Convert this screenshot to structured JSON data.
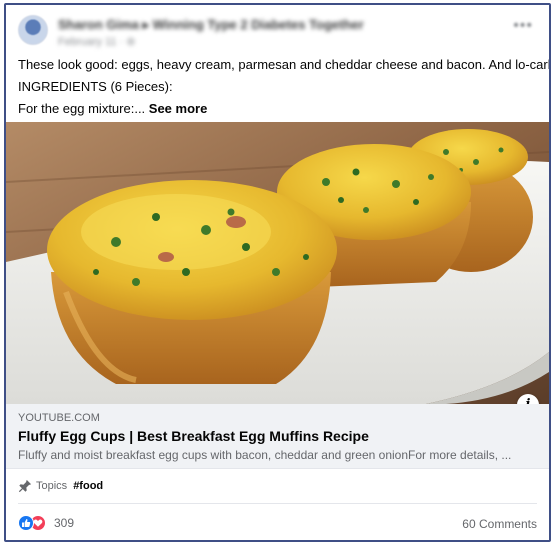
{
  "post": {
    "author_line": "Sharon Gima ▸ Winning Type 2 Diabetes Together",
    "date": "February 11 · ⊚",
    "menu_icon": "more-horizontal-icon",
    "text_lines": [
      "These look good: eggs, heavy cream, parmesan and cheddar cheese and bacon. And lo-carb.",
      "INGREDIENTS (6 Pieces):",
      "For the egg mixture:... "
    ],
    "see_more": "See more"
  },
  "link_preview": {
    "domain": "YOUTUBE.COM",
    "title": "Fluffy Egg Cups | Best Breakfast Egg Muffins Recipe",
    "description": "Fluffy and moist breakfast egg cups with bacon, cheddar and green onionFor more details, ...",
    "info_icon_label": "i"
  },
  "topics": {
    "label": "Topics",
    "tag": "#food"
  },
  "footer": {
    "reaction_count": "309",
    "comments": "60 Comments"
  },
  "colors": {
    "frame_border": "#3f4f86",
    "like_blue": "#1877f2",
    "love_red": "#f33e58",
    "link_card_bg": "#f0f2f5"
  }
}
